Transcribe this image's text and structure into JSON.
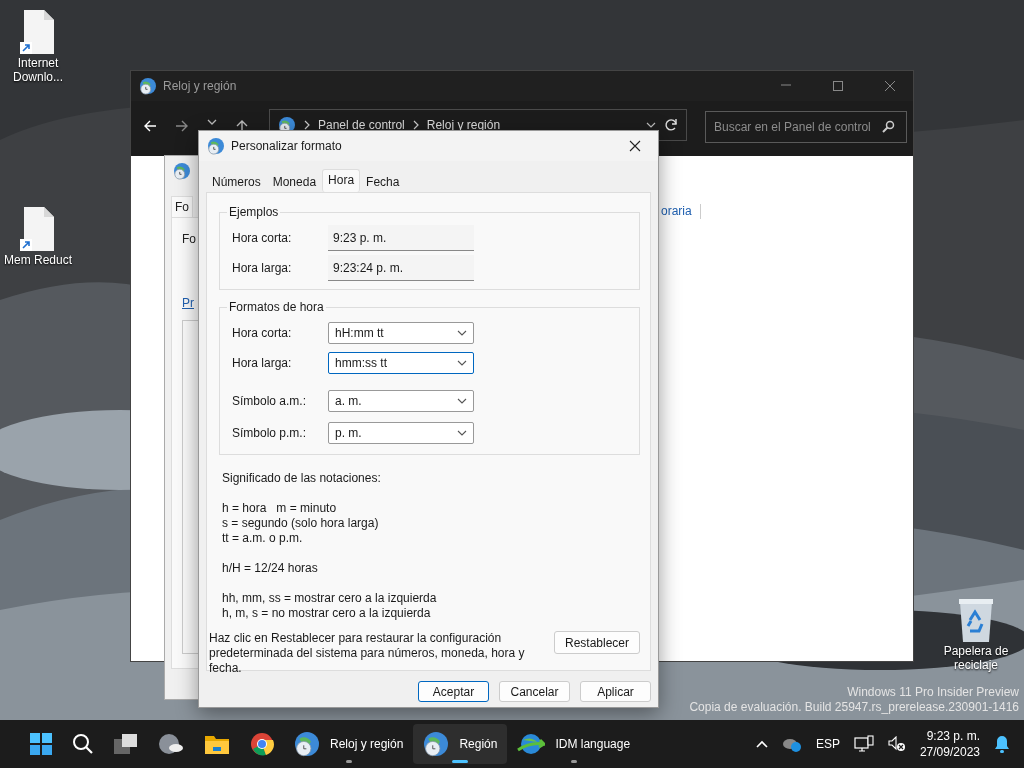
{
  "desktop_icons": [
    {
      "label": "Internet Downlo...",
      "kind": "shortcut"
    },
    {
      "label": "Mem Reduct",
      "kind": "shortcut"
    },
    {
      "label": "Papelera de reciclaje",
      "kind": "recycle"
    }
  ],
  "control_panel": {
    "title": "Reloj y región",
    "breadcrumb": [
      "Panel de control",
      "Reloj y región"
    ],
    "search": {
      "placeholder": "Buscar en el Panel de control"
    },
    "link_fragment": "oraria"
  },
  "region_window": {
    "tab": "Fo",
    "label": "Fo",
    "link": "Pr"
  },
  "dialog": {
    "title": "Personalizar formato",
    "tabs": [
      {
        "label": "Números",
        "selected": false
      },
      {
        "label": "Moneda",
        "selected": false
      },
      {
        "label": "Hora",
        "selected": true
      },
      {
        "label": "Fecha",
        "selected": false
      }
    ],
    "examples": {
      "title": "Ejemplos",
      "rows": [
        {
          "label": "Hora corta:",
          "value": "9:23 p. m."
        },
        {
          "label": "Hora larga:",
          "value": "9:23:24 p. m."
        }
      ]
    },
    "formats": {
      "title": "Formatos de hora",
      "rows": [
        {
          "label": "Hora corta:",
          "value": "hH:mm tt",
          "focused": false
        },
        {
          "label": "Hora larga:",
          "value": "hmm:ss tt",
          "focused": true
        },
        {
          "label": "Símbolo a.m.:",
          "value": "a. m.",
          "focused": false
        },
        {
          "label": "Símbolo p.m.:",
          "value": "p. m.",
          "focused": false
        }
      ]
    },
    "notation_title": "Significado de las notaciones:",
    "notation_groups": [
      [
        "h = hora   m = minuto",
        "s = segundo (solo hora larga)",
        "tt = a.m. o p.m."
      ],
      [
        "h/H = 12/24 horas"
      ],
      [
        "hh, mm, ss = mostrar cero a la izquierda",
        "h, m, s = no mostrar cero a la izquierda"
      ]
    ],
    "reset_text": "Haz clic en Restablecer para restaurar la configuración predeterminada del sistema para números, moneda, hora y fecha.",
    "reset_button": "Restablecer",
    "buttons": [
      {
        "label": "Aceptar",
        "default": true
      },
      {
        "label": "Cancelar",
        "default": false
      },
      {
        "label": "Aplicar",
        "default": false
      }
    ]
  },
  "watermark": [
    "Windows 11 Pro Insider Preview",
    "Copia de evaluación. Build 25947.rs_prerelease.230901-1416"
  ],
  "taskbar": {
    "apps": [
      {
        "kind": "start",
        "selected": false,
        "running": false
      },
      {
        "kind": "search",
        "selected": false,
        "running": false
      },
      {
        "kind": "taskview",
        "selected": false,
        "running": false
      },
      {
        "kind": "widgets",
        "selected": false,
        "running": false
      },
      {
        "kind": "explorer",
        "selected": false,
        "running": false
      },
      {
        "kind": "browser",
        "selected": false,
        "running": false
      },
      {
        "kind": "window",
        "label": "Reloj y región",
        "selected": false,
        "running": true
      },
      {
        "kind": "window",
        "label": "Región",
        "selected": true,
        "running": true
      },
      {
        "kind": "download",
        "label": "IDM language",
        "selected": false,
        "running": true
      }
    ],
    "language": "ESP",
    "time": "9:23 p. m.",
    "date": "27/09/2023"
  }
}
